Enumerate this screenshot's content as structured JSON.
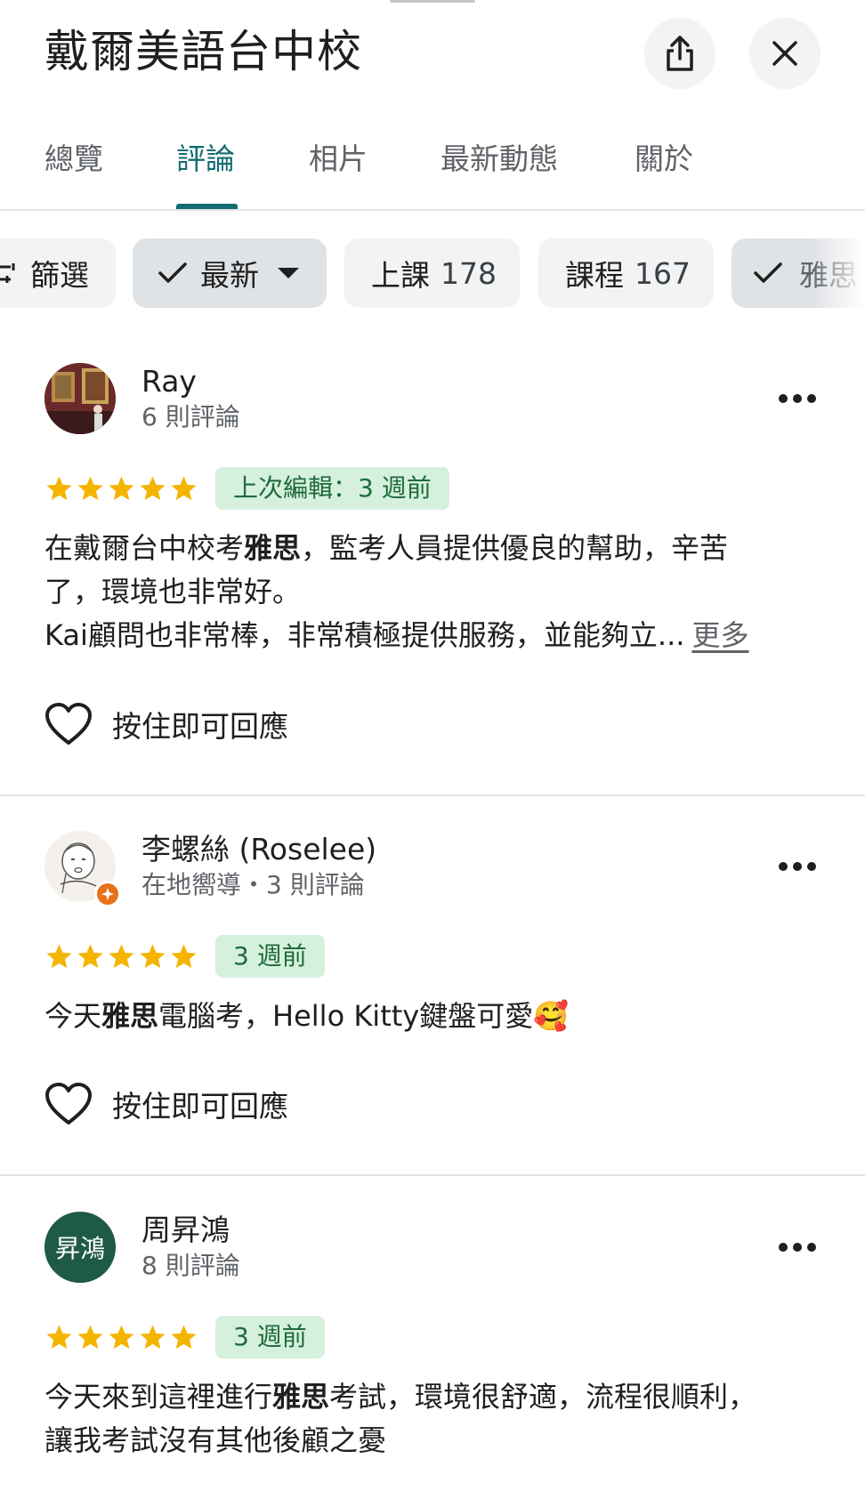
{
  "header": {
    "title": "戴爾美語台中校",
    "share_icon": "share-icon",
    "close_icon": "close-icon"
  },
  "tabs": [
    {
      "label": "總覽",
      "active": false
    },
    {
      "label": "評論",
      "active": true
    },
    {
      "label": "相片",
      "active": false
    },
    {
      "label": "最新動態",
      "active": false
    },
    {
      "label": "關於",
      "active": false
    }
  ],
  "filters": {
    "filter_label": "篩選",
    "sort_label": "最新",
    "chips": [
      {
        "label": "上課",
        "count": "178"
      },
      {
        "label": "課程",
        "count": "167"
      },
      {
        "label": "雅思",
        "selected": true
      }
    ]
  },
  "colors": {
    "accent": "#136c72",
    "star": "#f4b400",
    "badge_bg": "#d6f0de",
    "badge_text": "#1e6b3a"
  },
  "reviews": [
    {
      "name": "Ray",
      "meta": "6 則評論",
      "rating": 5,
      "time_badge": "上次編輯：3 週前",
      "text_lines": [
        {
          "pre": "在戴爾台中校考",
          "hl": "雅思",
          "post": "，監考人員提供優良的幫助，辛苦"
        },
        {
          "pre": "了，環境也非常好。",
          "hl": "",
          "post": ""
        },
        {
          "pre": "Kai顧問也非常棒，非常積極提供服務，並能夠立...",
          "hl": "",
          "post": ""
        }
      ],
      "more_label": "更多",
      "like_label": "按住即可回應"
    },
    {
      "name": "李螺絲 (Roselee)",
      "meta": "在地嚮導・3 則評論",
      "rating": 5,
      "time_badge": "3 週前",
      "text_lines": [
        {
          "pre": "今天",
          "hl": "雅思",
          "post": "電腦考，Hello Kitty鍵盤可愛🥰"
        }
      ],
      "like_label": "按住即可回應"
    },
    {
      "name": "周昇鴻",
      "meta": "8 則評論",
      "avatar_text": "昇鴻",
      "avatar_color": "#1e5a46",
      "rating": 5,
      "time_badge": "3 週前",
      "text_lines": [
        {
          "pre": "今天來到這裡進行",
          "hl": "雅思",
          "post": "考試，環境很舒適，流程很順利，"
        },
        {
          "pre": "讓我考試沒有其他後顧之憂",
          "hl": "",
          "post": ""
        }
      ]
    }
  ]
}
